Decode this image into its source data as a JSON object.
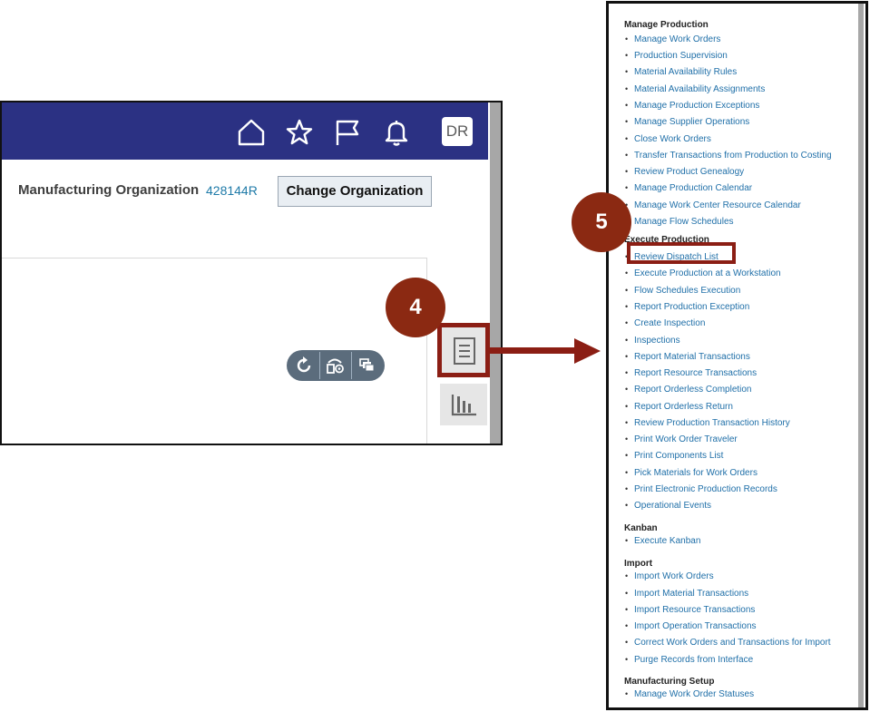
{
  "header": {
    "avatar_initials": "DR",
    "icons": [
      "home-icon",
      "star-icon",
      "flag-icon",
      "bell-icon"
    ],
    "bar_color": "#2b3183"
  },
  "main": {
    "org_label": "Manufacturing Organization",
    "org_code": "428144R",
    "change_org_label": "Change Organization"
  },
  "callouts": {
    "step4": "4",
    "step5": "5"
  },
  "accent_color": "#8b1e14",
  "tasks_panel": {
    "sections": [
      {
        "title": "Manage Production",
        "items": [
          "Manage Work Orders",
          "Production Supervision",
          "Material Availability Rules",
          "Material Availability Assignments",
          "Manage Production Exceptions",
          "Manage Supplier Operations",
          "Close Work Orders",
          "Transfer Transactions from Production to Costing",
          "Review Product Genealogy",
          "Manage Production Calendar",
          "Manage Work Center Resource Calendar",
          "Manage Flow Schedules"
        ]
      },
      {
        "title": "Execute Production",
        "items": [
          "Review Dispatch List",
          "Execute Production at a Workstation",
          "Flow Schedules Execution",
          "Report Production Exception",
          "Create Inspection",
          "Inspections",
          "Report Material Transactions",
          "Report Resource Transactions",
          "Report Orderless Completion",
          "Report Orderless Return",
          "Review Production Transaction History",
          "Print Work Order Traveler",
          "Print Components List",
          "Pick Materials for Work Orders",
          "Print Electronic Production Records",
          "Operational Events"
        ]
      },
      {
        "title": "Kanban",
        "items": [
          "Execute Kanban"
        ]
      },
      {
        "title": "Import",
        "items": [
          "Import Work Orders",
          "Import Material Transactions",
          "Import Resource Transactions",
          "Import Operation Transactions",
          "Correct Work Orders and Transactions for Import",
          "Purge Records from Interface"
        ]
      },
      {
        "title": "Manufacturing Setup",
        "items": [
          "Manage Work Order Statuses"
        ]
      }
    ]
  }
}
